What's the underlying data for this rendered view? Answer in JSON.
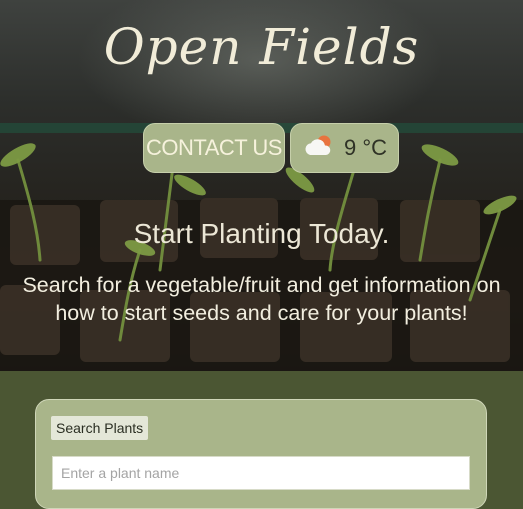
{
  "header": {
    "title": "Open Fields",
    "contact_label": "CONTACT US",
    "weather": {
      "icon": "cloud-sun-icon",
      "temperature": "9 °C"
    }
  },
  "hero": {
    "headline": "Start Planting Today.",
    "subtitle": "Search for a vegetable/fruit and get information on how to start seeds and care for your plants!"
  },
  "search": {
    "label": "Search Plants",
    "placeholder": "Enter a plant name",
    "value": ""
  },
  "colors": {
    "accent": "#a9b58a",
    "page_background": "#4b5633",
    "text_light": "#f1ecd8"
  }
}
